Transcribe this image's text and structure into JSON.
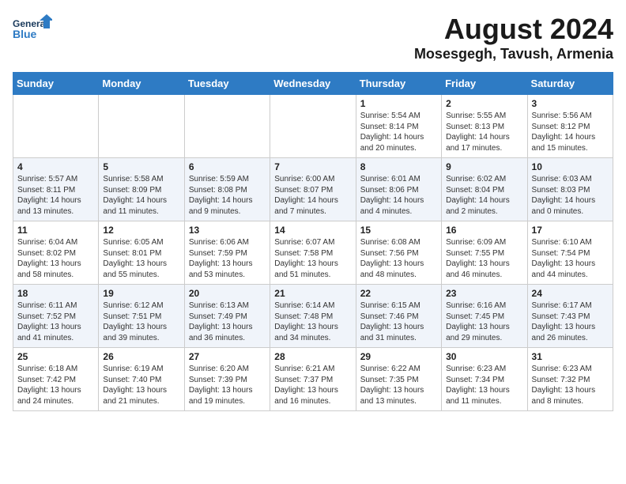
{
  "logo": {
    "line1": "General",
    "line2": "Blue"
  },
  "title": "August 2024",
  "location": "Mosesgegh, Tavush, Armenia",
  "days_of_week": [
    "Sunday",
    "Monday",
    "Tuesday",
    "Wednesday",
    "Thursday",
    "Friday",
    "Saturday"
  ],
  "weeks": [
    [
      {
        "day": "",
        "content": ""
      },
      {
        "day": "",
        "content": ""
      },
      {
        "day": "",
        "content": ""
      },
      {
        "day": "",
        "content": ""
      },
      {
        "day": "1",
        "content": "Sunrise: 5:54 AM\nSunset: 8:14 PM\nDaylight: 14 hours\nand 20 minutes."
      },
      {
        "day": "2",
        "content": "Sunrise: 5:55 AM\nSunset: 8:13 PM\nDaylight: 14 hours\nand 17 minutes."
      },
      {
        "day": "3",
        "content": "Sunrise: 5:56 AM\nSunset: 8:12 PM\nDaylight: 14 hours\nand 15 minutes."
      }
    ],
    [
      {
        "day": "4",
        "content": "Sunrise: 5:57 AM\nSunset: 8:11 PM\nDaylight: 14 hours\nand 13 minutes."
      },
      {
        "day": "5",
        "content": "Sunrise: 5:58 AM\nSunset: 8:09 PM\nDaylight: 14 hours\nand 11 minutes."
      },
      {
        "day": "6",
        "content": "Sunrise: 5:59 AM\nSunset: 8:08 PM\nDaylight: 14 hours\nand 9 minutes."
      },
      {
        "day": "7",
        "content": "Sunrise: 6:00 AM\nSunset: 8:07 PM\nDaylight: 14 hours\nand 7 minutes."
      },
      {
        "day": "8",
        "content": "Sunrise: 6:01 AM\nSunset: 8:06 PM\nDaylight: 14 hours\nand 4 minutes."
      },
      {
        "day": "9",
        "content": "Sunrise: 6:02 AM\nSunset: 8:04 PM\nDaylight: 14 hours\nand 2 minutes."
      },
      {
        "day": "10",
        "content": "Sunrise: 6:03 AM\nSunset: 8:03 PM\nDaylight: 14 hours\nand 0 minutes."
      }
    ],
    [
      {
        "day": "11",
        "content": "Sunrise: 6:04 AM\nSunset: 8:02 PM\nDaylight: 13 hours\nand 58 minutes."
      },
      {
        "day": "12",
        "content": "Sunrise: 6:05 AM\nSunset: 8:01 PM\nDaylight: 13 hours\nand 55 minutes."
      },
      {
        "day": "13",
        "content": "Sunrise: 6:06 AM\nSunset: 7:59 PM\nDaylight: 13 hours\nand 53 minutes."
      },
      {
        "day": "14",
        "content": "Sunrise: 6:07 AM\nSunset: 7:58 PM\nDaylight: 13 hours\nand 51 minutes."
      },
      {
        "day": "15",
        "content": "Sunrise: 6:08 AM\nSunset: 7:56 PM\nDaylight: 13 hours\nand 48 minutes."
      },
      {
        "day": "16",
        "content": "Sunrise: 6:09 AM\nSunset: 7:55 PM\nDaylight: 13 hours\nand 46 minutes."
      },
      {
        "day": "17",
        "content": "Sunrise: 6:10 AM\nSunset: 7:54 PM\nDaylight: 13 hours\nand 44 minutes."
      }
    ],
    [
      {
        "day": "18",
        "content": "Sunrise: 6:11 AM\nSunset: 7:52 PM\nDaylight: 13 hours\nand 41 minutes."
      },
      {
        "day": "19",
        "content": "Sunrise: 6:12 AM\nSunset: 7:51 PM\nDaylight: 13 hours\nand 39 minutes."
      },
      {
        "day": "20",
        "content": "Sunrise: 6:13 AM\nSunset: 7:49 PM\nDaylight: 13 hours\nand 36 minutes."
      },
      {
        "day": "21",
        "content": "Sunrise: 6:14 AM\nSunset: 7:48 PM\nDaylight: 13 hours\nand 34 minutes."
      },
      {
        "day": "22",
        "content": "Sunrise: 6:15 AM\nSunset: 7:46 PM\nDaylight: 13 hours\nand 31 minutes."
      },
      {
        "day": "23",
        "content": "Sunrise: 6:16 AM\nSunset: 7:45 PM\nDaylight: 13 hours\nand 29 minutes."
      },
      {
        "day": "24",
        "content": "Sunrise: 6:17 AM\nSunset: 7:43 PM\nDaylight: 13 hours\nand 26 minutes."
      }
    ],
    [
      {
        "day": "25",
        "content": "Sunrise: 6:18 AM\nSunset: 7:42 PM\nDaylight: 13 hours\nand 24 minutes."
      },
      {
        "day": "26",
        "content": "Sunrise: 6:19 AM\nSunset: 7:40 PM\nDaylight: 13 hours\nand 21 minutes."
      },
      {
        "day": "27",
        "content": "Sunrise: 6:20 AM\nSunset: 7:39 PM\nDaylight: 13 hours\nand 19 minutes."
      },
      {
        "day": "28",
        "content": "Sunrise: 6:21 AM\nSunset: 7:37 PM\nDaylight: 13 hours\nand 16 minutes."
      },
      {
        "day": "29",
        "content": "Sunrise: 6:22 AM\nSunset: 7:35 PM\nDaylight: 13 hours\nand 13 minutes."
      },
      {
        "day": "30",
        "content": "Sunrise: 6:23 AM\nSunset: 7:34 PM\nDaylight: 13 hours\nand 11 minutes."
      },
      {
        "day": "31",
        "content": "Sunrise: 6:23 AM\nSunset: 7:32 PM\nDaylight: 13 hours\nand 8 minutes."
      }
    ]
  ]
}
